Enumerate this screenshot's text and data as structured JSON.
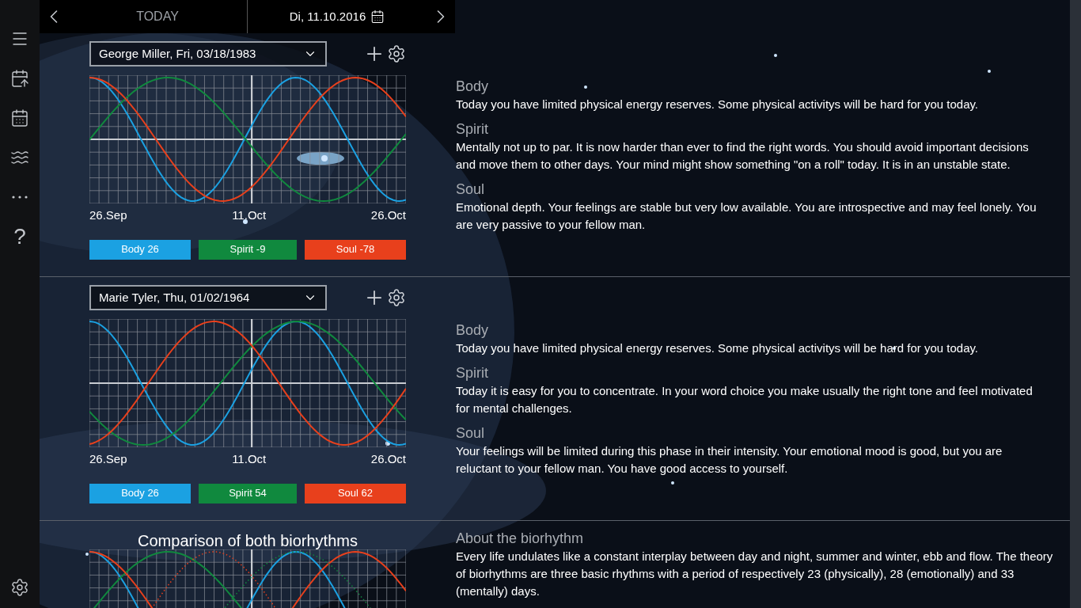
{
  "sidebar": {
    "help": "?"
  },
  "topbar": {
    "today": "TODAY",
    "date": "Di, 11.10.2016"
  },
  "persons": [
    {
      "name": "George Miller, Fri, 03/18/1983",
      "x_labels": [
        "26.Sep",
        "11.Oct",
        "26.Oct"
      ],
      "legend": [
        {
          "label": "Body 26",
          "color": "#1ba1e2"
        },
        {
          "label": "Spirit -9",
          "color": "#10893e"
        },
        {
          "label": "Soul -78",
          "color": "#e8401c"
        }
      ],
      "readings": [
        {
          "heading": "Body",
          "text": "Today you have limited physical energy reserves. Some physical activitys will be hard for you today."
        },
        {
          "heading": "Spirit",
          "text": "Mentally not up to par. It is now harder than ever to find the right words. You should avoid important decisions and move them to other days. Your mind might show something \"on a roll\" today. It is in an unstable state."
        },
        {
          "heading": "Soul",
          "text": "Emotional depth. Your feelings are stable but very low available. You are introspective and may feel lonely. You are very passive to your fellow man."
        }
      ]
    },
    {
      "name": "Marie Tyler, Thu, 01/02/1964",
      "x_labels": [
        "26.Sep",
        "11.Oct",
        "26.Oct"
      ],
      "legend": [
        {
          "label": "Body 26",
          "color": "#1ba1e2"
        },
        {
          "label": "Spirit 54",
          "color": "#10893e"
        },
        {
          "label": "Soul 62",
          "color": "#e8401c"
        }
      ],
      "readings": [
        {
          "heading": "Body",
          "text": "Today you have limited physical energy reserves. Some physical activitys will be hard for you today."
        },
        {
          "heading": "Spirit",
          "text": "Today it is easy for you to concentrate. In your word choice you make usually the right tone and feel motivated for mental challenges."
        },
        {
          "heading": "Soul",
          "text": "Your feelings will be limited during this phase in their intensity. Your emotional mood is good, but you are reluctant to your fellow man. You have good access to yourself."
        }
      ]
    }
  ],
  "comparison": {
    "title": "Comparison of both biorhythms",
    "about": {
      "heading": "About the biorhythm",
      "text": "Every life undulates like a constant interplay between day and night, summer and winter, ebb and flow. The theory of biorhythms are three basic rhythms with a period of respectively 23 (physically), 28 (emotionally) and 33 (mentally) days."
    }
  }
}
